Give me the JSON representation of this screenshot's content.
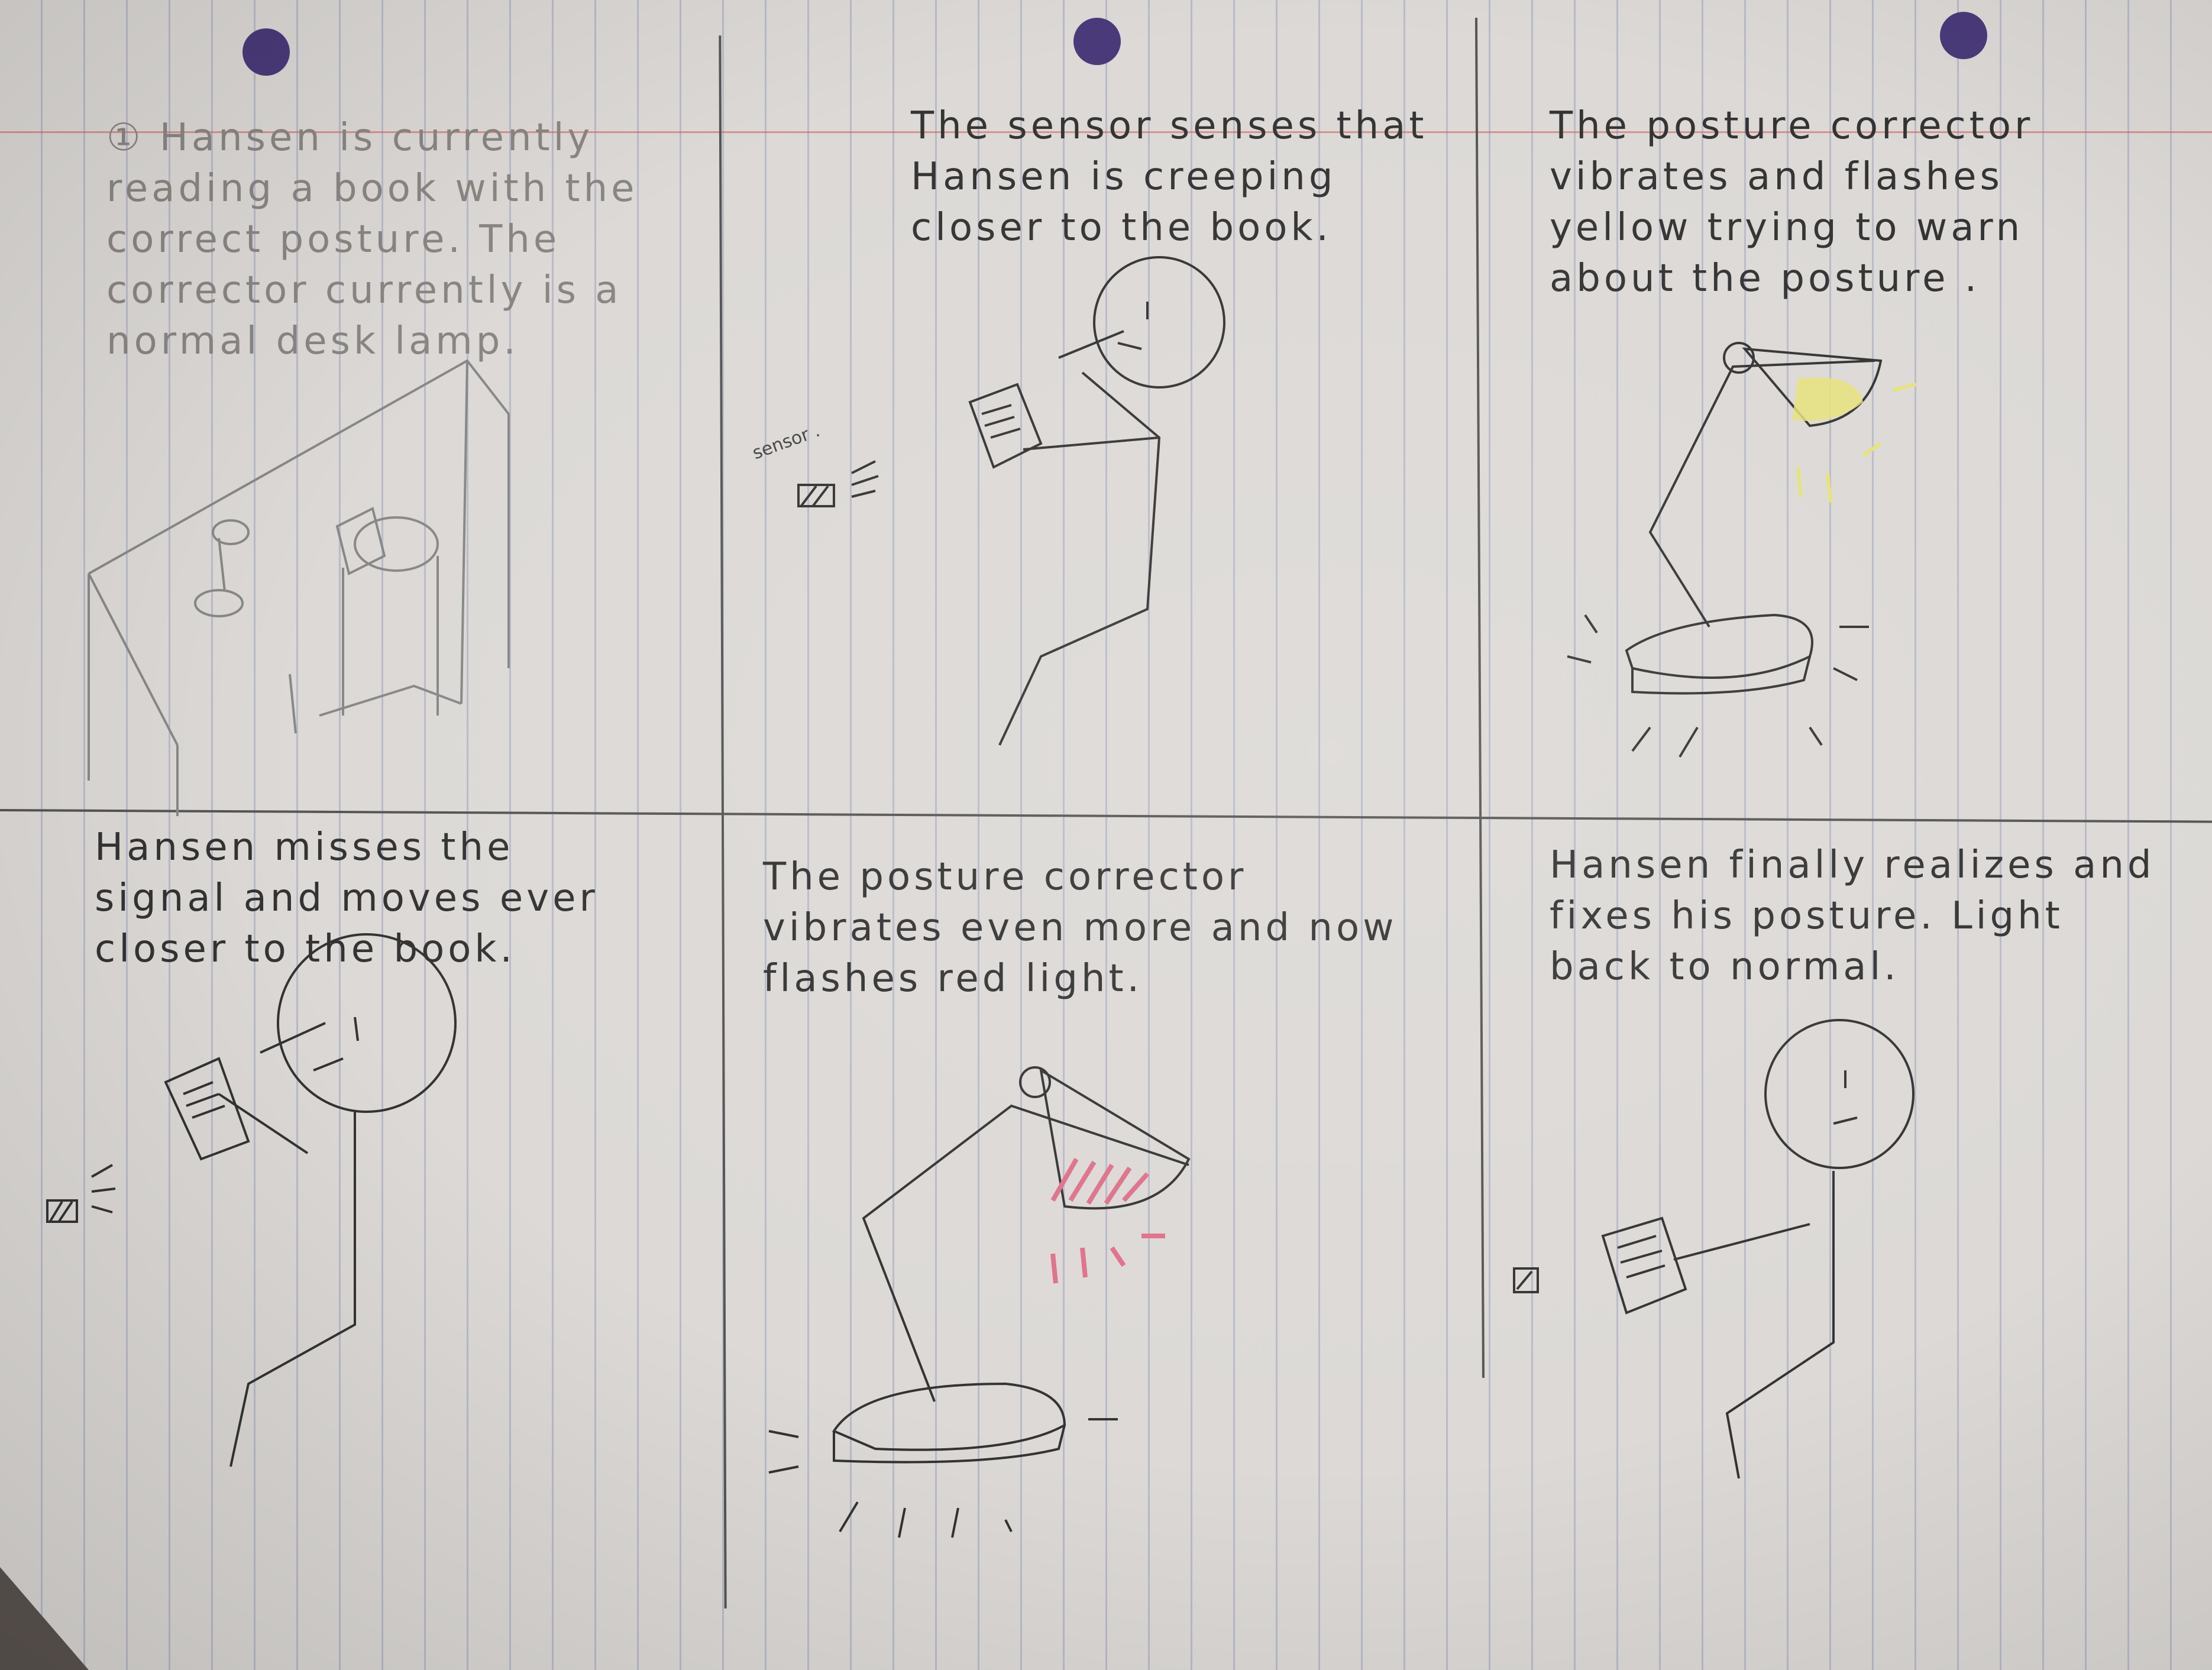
{
  "panels": [
    {
      "id": "p1",
      "caption": "① Hansen is currently reading a book with the correct posture. The corrector currently is a normal desk lamp."
    },
    {
      "id": "p2",
      "caption": "The sensor senses that Hansen is creeping closer to the book.",
      "sensor_label": "sensor ."
    },
    {
      "id": "p3",
      "caption": "The posture corrector vibrates and flashes yellow trying to warn about the posture ."
    },
    {
      "id": "p4",
      "caption": "Hansen misses the signal and moves ever closer to the book."
    },
    {
      "id": "p5",
      "caption": "The posture corrector vibrates even more and now flashes red light."
    },
    {
      "id": "p6",
      "caption": "Hansen finally realizes and fixes his posture. Light back to normal."
    }
  ],
  "colors": {
    "paper": "#dcd9d6",
    "pencil": "#333333",
    "yellow_light": "#e6e27a",
    "red_light": "#e0708a",
    "punch_hole": "#4a3a7a"
  }
}
